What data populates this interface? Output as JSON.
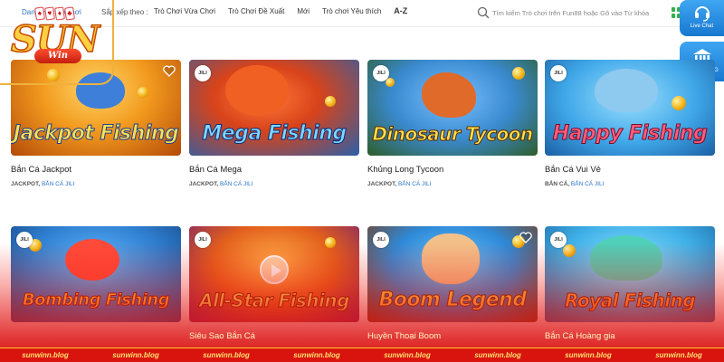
{
  "breadcrumb": "Danh mục trò chơi",
  "sort": {
    "label": "Sắp xếp theo :",
    "tabs": [
      "Trò Chơi Vừa Chơi",
      "Trò Chơi Đề Xuất",
      "Mới",
      "Trò chơi Yêu thích",
      "A-Z"
    ]
  },
  "search": {
    "placeholder": "Tìm kiếm Trò chơi trên Fun88 hoặc Gõ vào Từ khóa"
  },
  "float": {
    "chat": "Live Chat",
    "bank": "NGÂN HÀNG"
  },
  "logo": {
    "main": "SUN",
    "script": "Win"
  },
  "games": [
    {
      "title": "Jackpot Fishing",
      "name": "Bắn Cá Jackpot",
      "tag1": "JACKPOT,",
      "tag2": "BẮN CÁ JILI",
      "badge": "JILI"
    },
    {
      "title": "Mega Fishing",
      "name": "Bắn Cá Mega",
      "tag1": "JACKPOT,",
      "tag2": "BẮN CÁ JILI",
      "badge": "JILI"
    },
    {
      "title": "Dinosaur Tycoon",
      "name": "Khủng Long Tycoon",
      "tag1": "JACKPOT,",
      "tag2": "BẮN CÁ JILI",
      "badge": "JILI"
    },
    {
      "title": "Happy Fishing",
      "name": "Bắn Cá Vui Vẻ",
      "tag1": "BẮN CÁ,",
      "tag2": "BẮN CÁ JILI",
      "badge": "JILI"
    },
    {
      "title": "Bombing Fishing",
      "name": "",
      "badge": "JILI"
    },
    {
      "title": "All-Star Fishing",
      "name": "Siêu Sao Bắn Cá",
      "badge": "JILI"
    },
    {
      "title": "Boom Legend",
      "name": "Huyền Thoại Boom",
      "badge": "JILI"
    },
    {
      "title": "Royal Fishing",
      "name": "Bắn Cá Hoàng gia",
      "badge": "JILI"
    }
  ],
  "footer": [
    "sunwinn.blog",
    "sunwinn.blog",
    "sunwinn.blog",
    "sunwinn.blog",
    "sunwinn.blog",
    "sunwinn.blog",
    "sunwinn.blog",
    "sunwinn.blog"
  ],
  "colors": {
    "accent": "#2a74c9",
    "brand_red": "#d9140f",
    "gold": "#f0b13c",
    "float_blue": "#1878d0"
  }
}
